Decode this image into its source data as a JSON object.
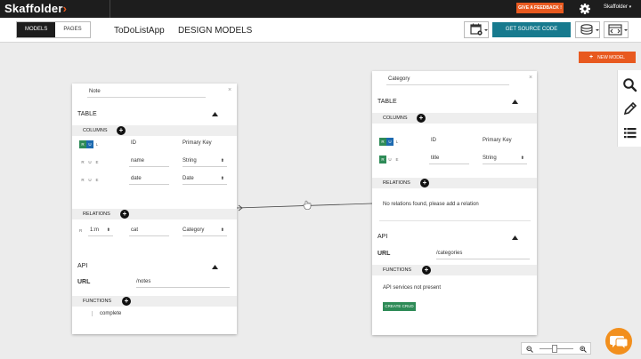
{
  "topbar": {
    "logo_text": "Skaffolder",
    "feedback_label": "GIVE A FEEDBACK !",
    "user_label": "Skaffolder",
    "user_caret": "▾"
  },
  "secondbar": {
    "tabs": [
      {
        "label": "MODELS",
        "active": true
      },
      {
        "label": "PAGES",
        "active": false
      }
    ],
    "app_name": "ToDoListApp",
    "section_name": "DESIGN MODELS",
    "get_source_label": "GET SOURCE CODE"
  },
  "canvas": {
    "new_model_plus": "+",
    "new_model_label": "NEW MODEL"
  },
  "note_model": {
    "name": "Note",
    "close_glyph": "×",
    "table_label": "TABLE",
    "columns_label": "COLUMNS",
    "columns": [
      {
        "flags": [
          "R",
          "U",
          "L"
        ],
        "flags_on": [
          true,
          true,
          false
        ],
        "name": "ID",
        "type": "Primary Key",
        "editable": false
      },
      {
        "flags": [
          "R",
          "U",
          "E"
        ],
        "flags_on": [
          false,
          false,
          false
        ],
        "name": "name",
        "type": "String",
        "editable": true
      },
      {
        "flags": [
          "R",
          "U",
          "E"
        ],
        "flags_on": [
          false,
          false,
          false
        ],
        "name": "date",
        "type": "Date",
        "editable": true
      }
    ],
    "relations_label": "RELATIONS",
    "relations": [
      {
        "flag": "R",
        "cardinality": "1:m",
        "name": "cat",
        "target": "Category"
      }
    ],
    "api_label": "API",
    "url_label": "URL",
    "url_value": "/notes",
    "functions_label": "FUNCTIONS",
    "functions": [
      "complete"
    ]
  },
  "category_model": {
    "name": "Category",
    "close_glyph": "×",
    "table_label": "TABLE",
    "columns_label": "COLUMNS",
    "columns": [
      {
        "flags": [
          "R",
          "U",
          "L"
        ],
        "flags_on": [
          true,
          true,
          false
        ],
        "name": "ID",
        "type": "Primary Key",
        "editable": false
      },
      {
        "flags": [
          "R",
          "U",
          "E"
        ],
        "flags_on": [
          true,
          false,
          false
        ],
        "name": "title",
        "type": "String",
        "editable": true
      }
    ],
    "relations_label": "RELATIONS",
    "relations_empty": "No relations found, please add a relation",
    "api_label": "API",
    "url_label": "URL",
    "url_value": "/categories",
    "functions_label": "FUNCTIONS",
    "functions_empty": "API services not present",
    "create_crud_label": "CREATE CRUD"
  },
  "zoom": {
    "zoom_out_glyph": "🔍",
    "zoom_in_glyph": "🔍"
  },
  "colors": {
    "accent_orange": "#e8591f",
    "primary_teal": "#177a8e",
    "flag_green": "#2e8b57",
    "chat_orange": "#f28f1d",
    "topbar_dark": "#1d1d1d"
  }
}
